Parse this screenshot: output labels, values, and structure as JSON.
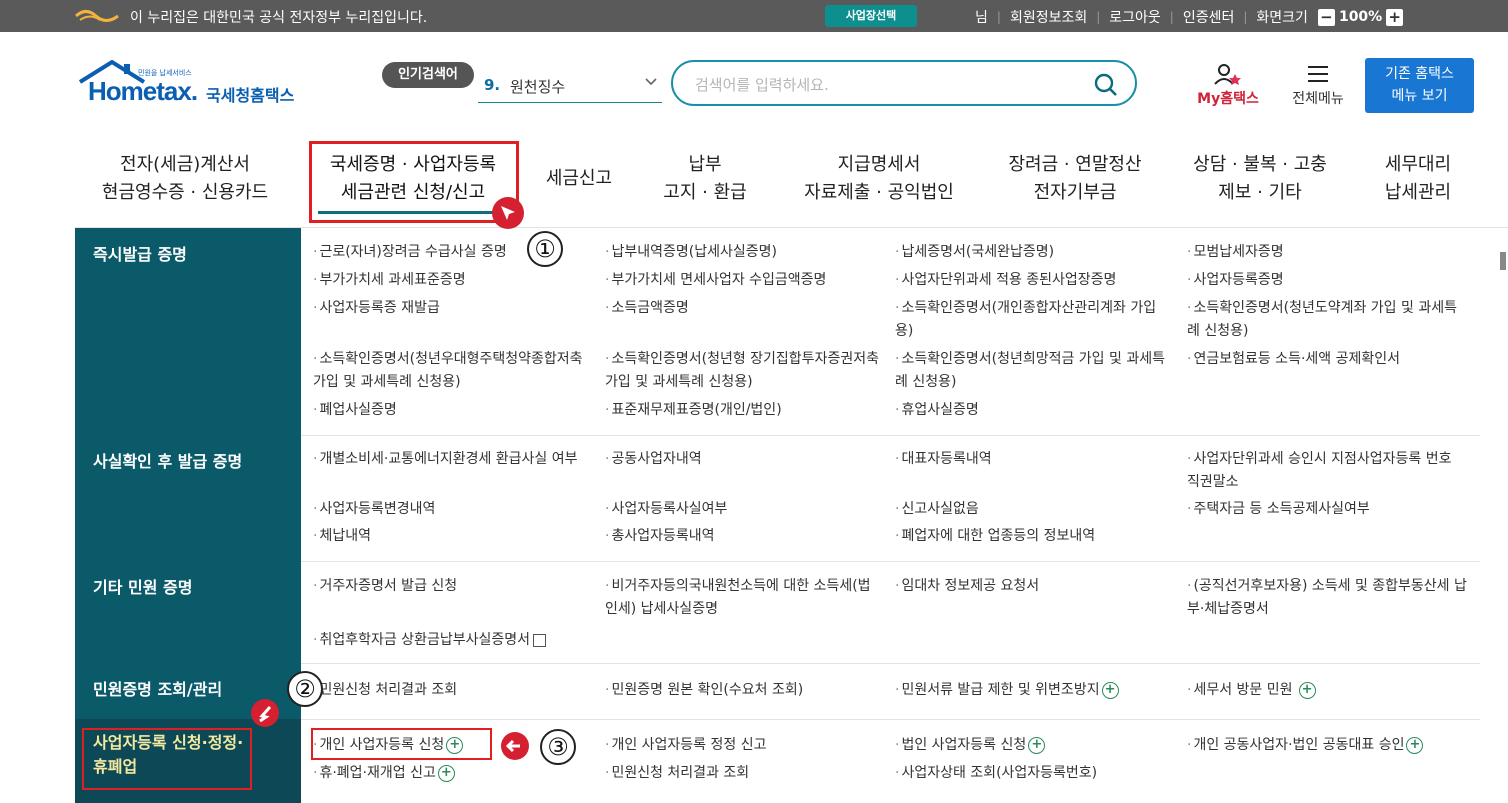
{
  "govbar": {
    "notice": "이 누리집은 대한민국 공식 전자정부 누리집입니다.",
    "business_select": "사업장선택",
    "links": [
      "님",
      "회원정보조회",
      "로그아웃",
      "인증센터",
      "화면크기"
    ],
    "zoom_minus": "−",
    "zoom_level": "100%",
    "zoom_plus": "+"
  },
  "logo": {
    "tagline": "민원을 납세서비스",
    "brand": "Hometax.",
    "name": "국세청홈택스"
  },
  "header": {
    "popular_label": "인기검색어",
    "popular_rank": "9.",
    "popular_keyword": "원천징수",
    "search_placeholder": "검색어를 입력하세요.",
    "my_hometax": "My홈택스",
    "all_menu": "전체메뉴",
    "old_menu_line1": "기존 홈택스",
    "old_menu_line2": "메뉴 보기"
  },
  "nav": [
    {
      "line1": "전자(세금)계산서",
      "line2": "현금영수증 · 신용카드"
    },
    {
      "line1": "국세증명 · 사업자등록",
      "line2": "세금관련 신청/신고"
    },
    {
      "line1": "세금신고",
      "line2": ""
    },
    {
      "line1": "납부",
      "line2": "고지 · 환급"
    },
    {
      "line1": "지급명세서",
      "line2": "자료제출 · 공익법인"
    },
    {
      "line1": "장려금 · 연말정산",
      "line2": "전자기부금"
    },
    {
      "line1": "상담 · 불복 · 고충",
      "line2": "제보 · 기타"
    },
    {
      "line1": "세무대리",
      "line2": "납세관리"
    }
  ],
  "annotations": {
    "one": "①",
    "two": "②",
    "three": "③"
  },
  "sections": {
    "s1": {
      "title": "즉시발급 증명",
      "items": [
        "근로(자녀)장려금 수급사실 증명",
        "납부내역증명(납세사실증명)",
        "납세증명서(국세완납증명)",
        "모범납세자증명",
        "부가가치세 과세표준증명",
        "부가가치세 면세사업자 수입금액증명",
        "사업자단위과세 적용 종된사업장증명",
        "사업자등록증명",
        "사업자등록증 재발급",
        "소득금액증명",
        "소득확인증명서(개인종합자산관리계좌 가입용)",
        "소득확인증명서(청년도약계좌 가입 및 과세특례 신청용)",
        "소득확인증명서(청년우대형주택청약종합저축 가입 및 과세특례 신청용)",
        "소득확인증명서(청년형 장기집합투자증권저축 가입 및 과세특례 신청용)",
        "소득확인증명서(청년희망적금 가입 및 과세특례 신청용)",
        "연금보험료등 소득·세액 공제확인서",
        "폐업사실증명",
        "표준재무제표증명(개인/법인)",
        "휴업사실증명"
      ]
    },
    "s2": {
      "title": "사실확인 후 발급 증명",
      "items": [
        "개별소비세·교통에너지환경세 환급사실 여부",
        "공동사업자내역",
        "대표자등록내역",
        "사업자단위과세 승인시 지점사업자등록 번호 직권말소",
        "사업자등록변경내역",
        "사업자등록사실여부",
        "신고사실없음",
        "주택자금 등 소득공제사실여부",
        "체납내역",
        "총사업자등록내역",
        "폐업자에 대한 업종등의 정보내역"
      ]
    },
    "s3": {
      "title": "기타 민원 증명",
      "items": [
        "거주자증명서 발급 신청",
        "비거주자등의국내원천소득에 대한 소득세(법인세) 납세사실증명",
        "임대차 정보제공 요청서",
        "(공직선거후보자용) 소득세 및 종합부동산세 납부·체납증명서",
        "취업후학자금 상환금납부사실증명서"
      ]
    },
    "s4": {
      "title": "민원증명 조회/관리",
      "items": [
        "민원신청 처리결과 조회",
        "민원증명 원본 확인(수요처 조회)",
        "민원서류 발급 제한 및 위변조방지",
        "세무서 방문 민원"
      ]
    },
    "s5": {
      "title_line1": "사업자등록 신청·정정·",
      "title_line2": "휴폐업",
      "items": [
        "개인 사업자등록 신청",
        "개인 사업자등록 정정 신고",
        "법인 사업자등록 신청",
        "개인 공동사업자·법인 공동대표 승인",
        "휴·폐업·재개업 신고",
        "민원신청 처리결과 조회",
        "사업자상태 조회(사업자등록번호)"
      ]
    }
  },
  "colors": {
    "teal_head": "#0a5a6a",
    "accent_red": "#e02020",
    "brand_blue": "#0a5fb0"
  }
}
